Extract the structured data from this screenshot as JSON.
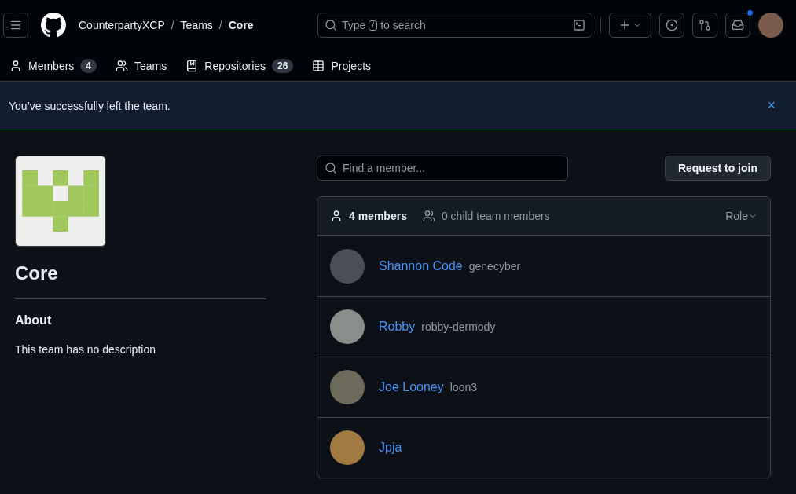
{
  "header": {
    "breadcrumbs": [
      "CounterpartyXCP",
      "Teams",
      "Core"
    ],
    "separator": "/",
    "search": {
      "placeholder_before": "Type",
      "key": "/",
      "placeholder_after": "to search"
    },
    "notification_dot": true
  },
  "tabs": [
    {
      "label": "Members",
      "count": "4"
    },
    {
      "label": "Teams"
    },
    {
      "label": "Repositories",
      "count": "26"
    },
    {
      "label": "Projects"
    }
  ],
  "flash": {
    "message": "You’ve successfully left the team.",
    "close": "×"
  },
  "team": {
    "name": "Core",
    "about_title": "About",
    "description": "This team has no description"
  },
  "member_search": {
    "placeholder": "Find a member..."
  },
  "join_button": "Request to join",
  "members_header": {
    "count": "4 members",
    "child_count": "0 child team members",
    "role_filter": "Role"
  },
  "members": [
    {
      "name": "Shannon Code",
      "username": "genecyber"
    },
    {
      "name": "Robby",
      "username": "robby-dermody"
    },
    {
      "name": "Joe Looney",
      "username": "loon3"
    },
    {
      "name": "Jpja"
    }
  ]
}
